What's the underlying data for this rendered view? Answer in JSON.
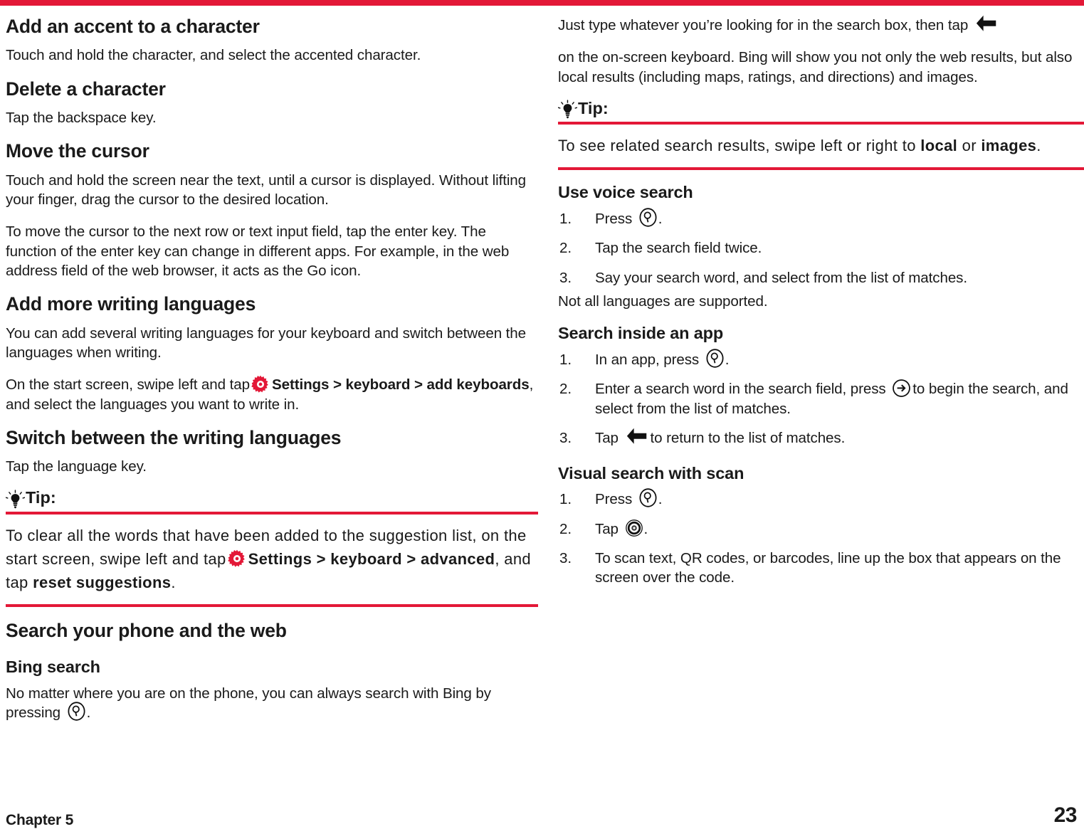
{
  "theme": {
    "accent": "#e31837",
    "text": "#1a1a1a",
    "background": "#ffffff"
  },
  "left_column": {
    "s1": {
      "heading": "Add an accent to a character",
      "body": "Touch and hold the character, and select the accented character."
    },
    "s2": {
      "heading": "Delete a character",
      "body": "Tap the backspace key."
    },
    "s3": {
      "heading": "Move the cursor",
      "p1": "Touch and hold the screen near the text, until a cursor is displayed. Without lifting your finger, drag the cursor to the desired location.",
      "p2": "To move the cursor to the next row or text input field, tap the enter key. The function of the enter key can change in different apps. For example, in the web address field of the web browser, it acts as the Go icon."
    },
    "s4": {
      "heading": "Add more writing languages",
      "p1": "You can add several writing languages for your keyboard and switch between the languages when writing.",
      "p2_before": "On the start screen, swipe left and tap",
      "p2_icon": "gear-icon",
      "p2_bold1": "Settings > keyboard > add keyboards",
      "p2_after": ", and select the languages you want to write in."
    },
    "s5": {
      "heading": "Switch between the writing languages",
      "body": "Tap the language key."
    },
    "tip": {
      "icon": "lightbulb-icon",
      "label": "Tip:",
      "text_before": "To clear all the words that have been added to the suggestion list, on the start screen, swipe left and tap",
      "icon_inline": "gear-icon",
      "bold1": "Settings > keyboard > advanced",
      "text_mid": ", and tap",
      "bold2": "reset suggestions",
      "text_after": "."
    },
    "s6": {
      "heading": "Search your phone and the web"
    },
    "s7": {
      "heading": "Bing search",
      "text_before": "No matter where you are on the phone, you can always search with Bing by pressing",
      "icon": "search-key-icon",
      "text_after": "."
    }
  },
  "right_column": {
    "r1": {
      "text_before": "Just type whatever you’re looking for in the search box, then tap",
      "icon": "back-arrow-icon",
      "text_after": "on the on-screen keyboard. Bing will show you not only the web results, but also local results (including maps, ratings, and directions) and images."
    },
    "tip": {
      "icon": "lightbulb-icon",
      "label": "Tip:",
      "text_before": "To see related search results, swipe left or right to",
      "bold1": "local",
      "text_mid": "or",
      "bold2": "images",
      "text_after": "."
    },
    "s1": {
      "heading": "Use voice search",
      "steps": [
        {
          "before": "Press",
          "icon": "search-key-icon",
          "after": "."
        },
        {
          "before": "Tap the search field twice.",
          "icon": "",
          "after": ""
        },
        {
          "before": "Say your search word, and select from the list of matches.",
          "icon": "",
          "after": ""
        }
      ],
      "note": "Not all languages are supported."
    },
    "s2": {
      "heading": "Search inside an app",
      "steps": [
        {
          "before": "In an app, press",
          "icon": "search-key-icon",
          "after": "."
        },
        {
          "before": "Enter a search word in the search field, press",
          "icon": "enter-arrow-icon",
          "after": "to begin the search, and select from the list of matches."
        },
        {
          "before": "Tap",
          "icon": "back-arrow-icon",
          "after": "to return to the list of matches."
        }
      ]
    },
    "s3": {
      "heading": "Visual search with scan",
      "steps": [
        {
          "before": "Press",
          "icon": "search-key-icon",
          "after": "."
        },
        {
          "before": "Tap",
          "icon": "scan-icon",
          "after": "."
        },
        {
          "before": "To scan text, QR codes, or barcodes, line up the box that appears on the screen over the code.",
          "icon": "",
          "after": ""
        }
      ]
    }
  },
  "footer": {
    "chapter": "Chapter 5",
    "page_number": "23"
  }
}
